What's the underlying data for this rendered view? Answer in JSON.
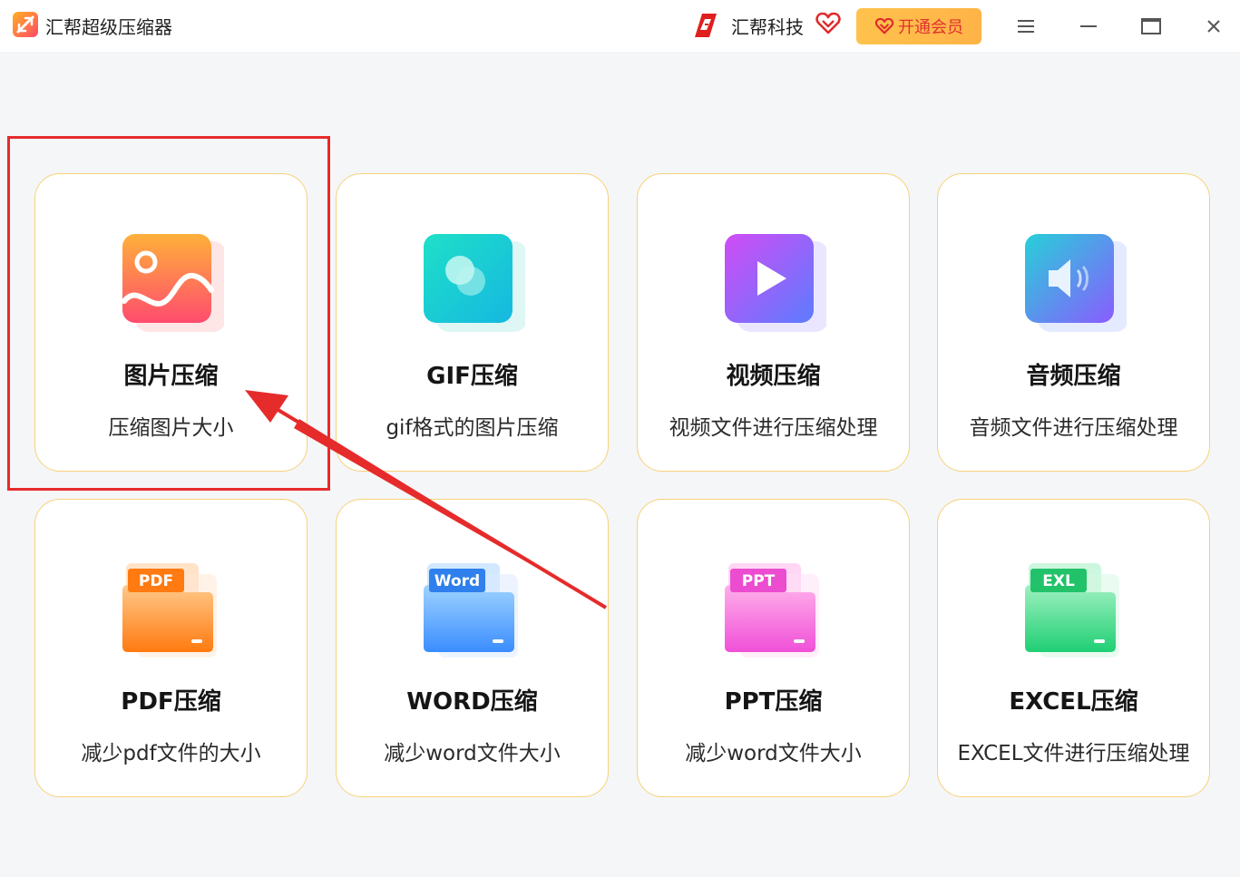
{
  "titlebar": {
    "app_title": "汇帮超级压缩器",
    "brand_name": "汇帮科技",
    "vip_label": "开通会员"
  },
  "cards": [
    {
      "title": "图片压缩",
      "desc": "压缩图片大小",
      "icon": "image-icon"
    },
    {
      "title": "GIF压缩",
      "desc": "gif格式的图片压缩",
      "icon": "gif-icon"
    },
    {
      "title": "视频压缩",
      "desc": "视频文件进行压缩处理",
      "icon": "video-play-icon"
    },
    {
      "title": "音频压缩",
      "desc": "音频文件进行压缩处理",
      "icon": "audio-speaker-icon"
    },
    {
      "title": "PDF压缩",
      "desc": "减少pdf文件的大小",
      "icon": "pdf-folder-icon",
      "badge": "PDF"
    },
    {
      "title": "WORD压缩",
      "desc": "减少word文件大小",
      "icon": "word-folder-icon",
      "badge": "Word"
    },
    {
      "title": "PPT压缩",
      "desc": "减少word文件大小",
      "icon": "ppt-folder-icon",
      "badge": "PPT"
    },
    {
      "title": "EXCEL压缩",
      "desc": "EXCEL文件进行压缩处理",
      "icon": "excel-folder-icon",
      "badge": "EXL"
    }
  ],
  "colors": {
    "accent_red": "#e62b2b",
    "card_border": "#f6d27a",
    "vip_bg": "#ffbe4a"
  }
}
